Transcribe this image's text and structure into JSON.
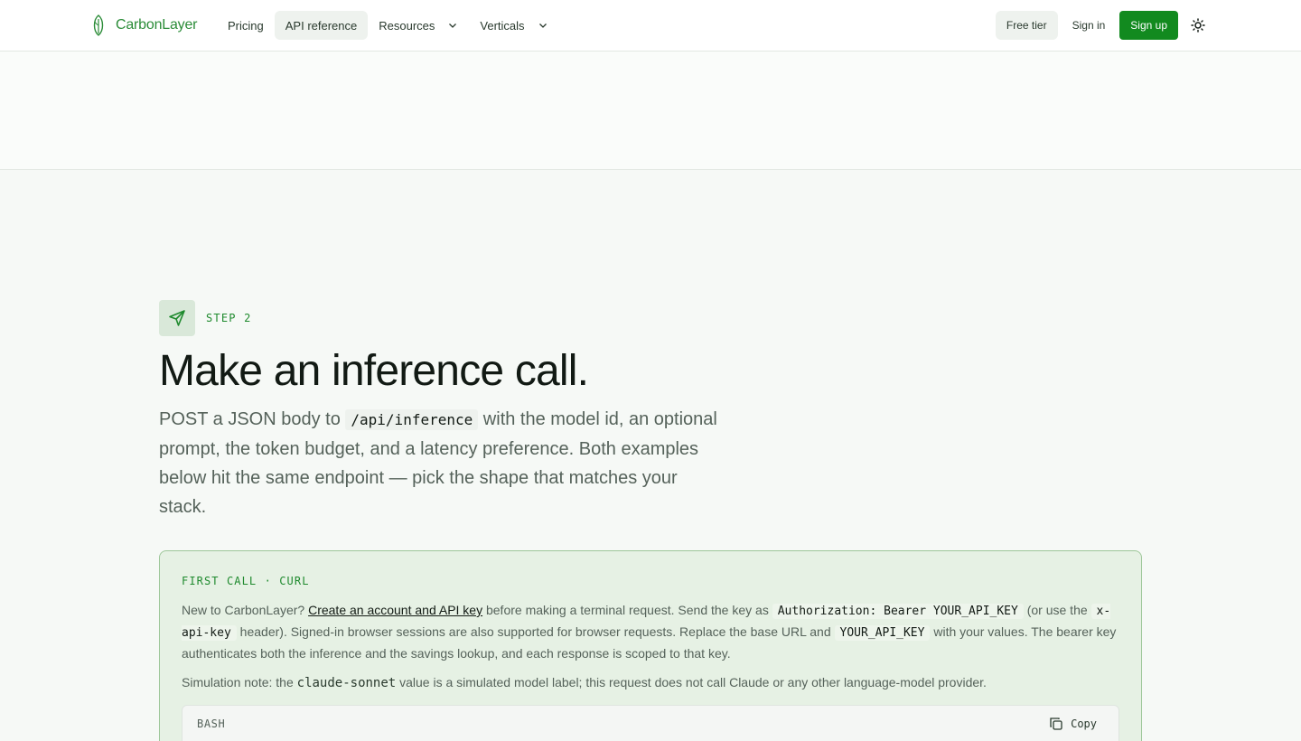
{
  "header": {
    "brand": "CarbonLayer",
    "nav": [
      {
        "label": "Pricing",
        "has_menu": false,
        "active": false
      },
      {
        "label": "API reference",
        "has_menu": false,
        "active": true
      },
      {
        "label": "Resources",
        "has_menu": true,
        "active": false
      },
      {
        "label": "Verticals",
        "has_menu": true,
        "active": false
      }
    ],
    "free_tier": "Free tier",
    "sign_in": "Sign in",
    "sign_up": "Sign up",
    "theme_icon": "sun-icon"
  },
  "step": {
    "icon": "send-icon",
    "label": "STEP 2",
    "heading": "Make an inference call.",
    "lede_1": "POST a JSON body to ",
    "lede_code": "/api/inference",
    "lede_2": " with the model id, an optional prompt, the token budget, and a latency preference. Both examples below hit the same endpoint — pick the shape that matches your stack."
  },
  "card": {
    "eyebrow": "FIRST CALL · CURL",
    "t1": "New to CarbonLayer? ",
    "link": "Create an account and API key",
    "t2": " before making a terminal request. Send the key as ",
    "c1": "Authorization: Bearer YOUR_API_KEY",
    "t3": " (or use the ",
    "c2": "x-api-key",
    "t4": " header). Signed-in browser sessions are also supported for browser requests. Replace the base URL and ",
    "c3": "YOUR_API_KEY",
    "t5": " with your values. The bearer key authenticates both the inference and the savings lookup, and each response is scoped to that key.",
    "note_1": "Simulation note: the ",
    "note_code": "claude-sonnet",
    "note_2": " value is a simulated model label; this request does not call Claude or any other language-model provider.",
    "code_lang": "BASH",
    "copy_label": "Copy"
  },
  "colors": {
    "accent": "#1f8a2e",
    "signup_bg": "#128a1f",
    "card_bg": "#e6f1e4",
    "card_border": "#9ec79a"
  }
}
